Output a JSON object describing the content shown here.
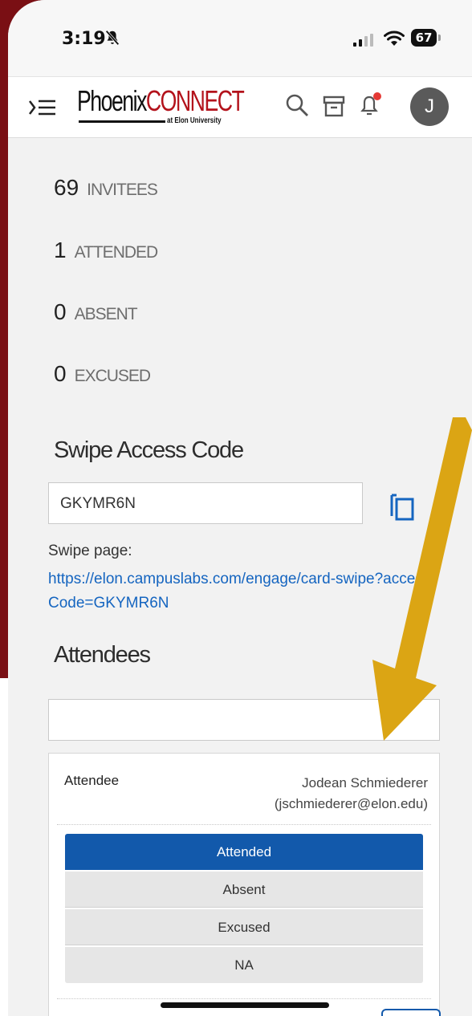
{
  "status_bar": {
    "time": "3:19",
    "battery": "67"
  },
  "header": {
    "logo_main": "Phoenix",
    "logo_accent": "CONNECT",
    "logo_sub": "at Elon University",
    "avatar_initial": "J"
  },
  "stats": [
    {
      "value": "69",
      "label": "INVITEES"
    },
    {
      "value": "1",
      "label": "ATTENDED"
    },
    {
      "value": "0",
      "label": "ABSENT"
    },
    {
      "value": "0",
      "label": "EXCUSED"
    }
  ],
  "swipe": {
    "title": "Swipe Access Code",
    "code": "GKYMR6N",
    "page_label": "Swipe page:",
    "page_link": "https://elon.campuslabs.com/engage/card-swipe?accessCode=GKYMR6N"
  },
  "attendees": {
    "title": "Attendees",
    "search_value": "",
    "card": {
      "label": "Attendee",
      "name": "Jodean Schmiederer",
      "email": "(jschmiederer@elon.edu)",
      "options": [
        "Attended",
        "Absent",
        "Excused",
        "NA"
      ],
      "selected": "Attended"
    }
  },
  "colors": {
    "frame": "#7a0f14",
    "primary": "#1259ab",
    "link": "#1565c0",
    "logo_accent": "#b3121b",
    "arrow": "#dba514"
  }
}
